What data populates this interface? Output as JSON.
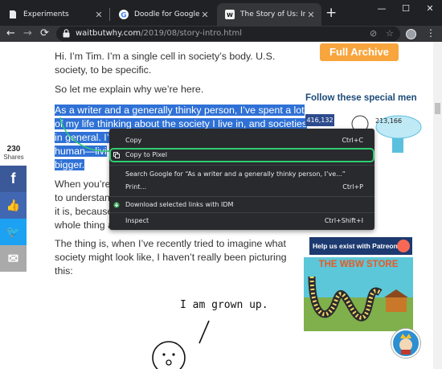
{
  "browser": {
    "tabs": [
      {
        "title": "Experiments",
        "active": false
      },
      {
        "title": "Doodle for Google",
        "active": false
      },
      {
        "title": "The Story of Us: Intro —",
        "active": true
      }
    ],
    "new_tab": "+",
    "window_controls": {
      "minimize": "—",
      "maximize": "☐",
      "close": "✕"
    },
    "url_host": "waitbutwhy.com",
    "url_path": "/2019/08/story-intro.html"
  },
  "page": {
    "paragraphs": [
      "Hi. I’m Tim. I’m a single cell in society’s body. U.S.",
      "society, to be specific.",
      "So let me explain why we’re here.",
      "As a writer and a generally thinky person, I’ve spent a lot",
      "of my life thinking about the society I live in, and societies",
      "in general. I’v",
      "human—livi",
      "bigger.",
      "When you’re",
      "to understan",
      "it is, because",
      "whole thing a",
      "The thing is, when I’ve recently tried to imagine what",
      "society might look like, I haven’t really been picturing",
      "this:"
    ],
    "shares": {
      "count": "230",
      "label": "Shares"
    },
    "social_icons": [
      "f",
      "👍",
      "🐦",
      "✉"
    ],
    "full_archive": "Full Archive",
    "follow": "Follow these special men",
    "fb_followers": "416,132",
    "tw_followers": "213,166",
    "patreon": "Help us exist with Patreon",
    "store": "THE WBW STORE",
    "comic_text": "I am grown up."
  },
  "context_menu": {
    "items": [
      {
        "label": "Copy",
        "shortcut": "Ctrl+C"
      },
      {
        "label": "Copy to Pixel",
        "shortcut": ""
      },
      {
        "label": "Search Google for “As a writer and a generally thinky person, I’ve...”",
        "shortcut": ""
      },
      {
        "label": "Print...",
        "shortcut": "Ctrl+P"
      },
      {
        "label": "Download selected links with IDM",
        "shortcut": ""
      },
      {
        "label": "Inspect",
        "shortcut": "Ctrl+Shift+I"
      }
    ]
  },
  "colors": {
    "selection": "#2f71d6",
    "highlight_outline": "#2ecc71",
    "archive": "#f8a53d"
  }
}
